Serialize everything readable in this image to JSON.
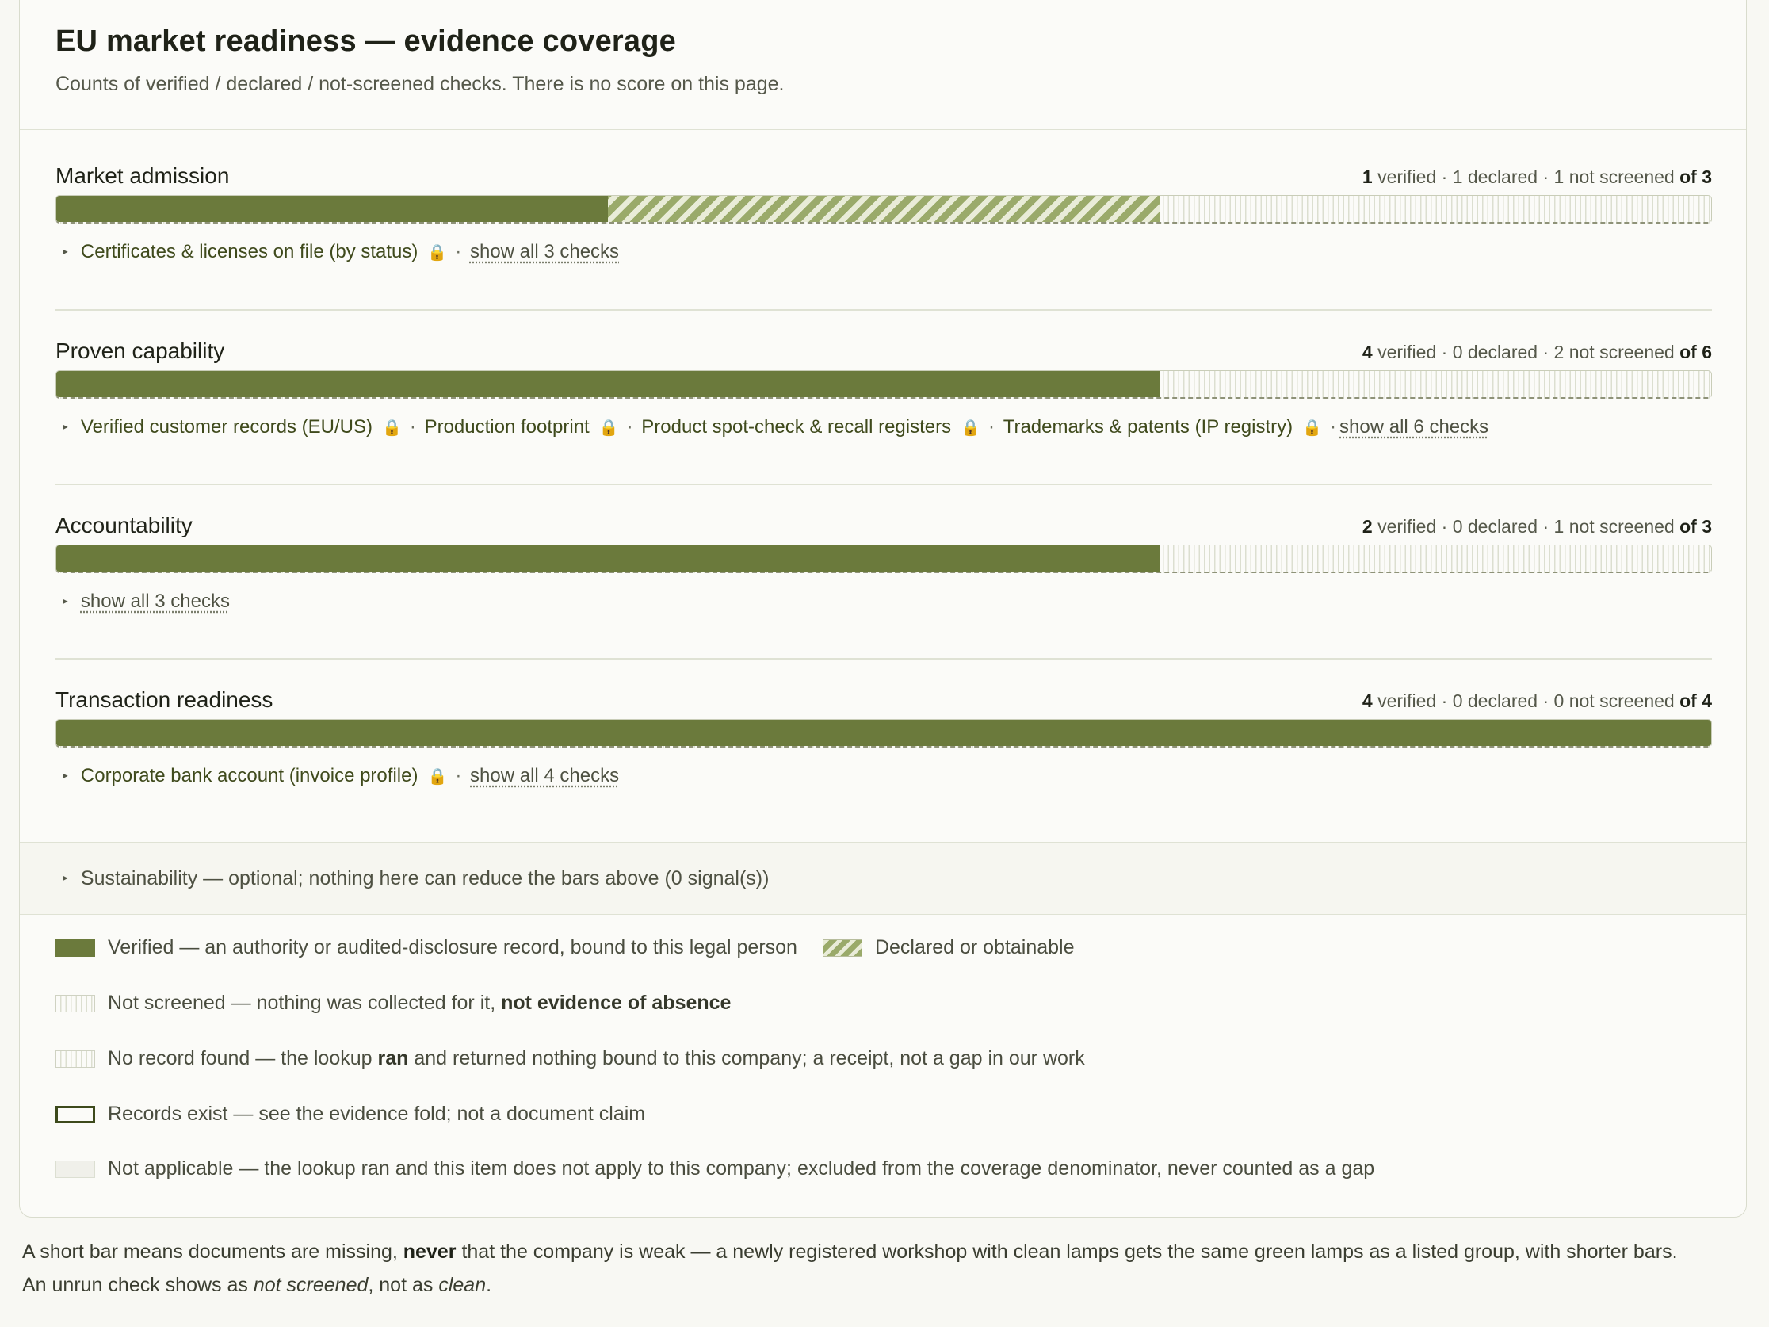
{
  "header": {
    "title": "EU market readiness — evidence coverage",
    "subtitle": "Counts of verified / declared / not-screened checks. There is no score on this page."
  },
  "sections": [
    {
      "name": "Market admission",
      "verified": 1,
      "declared": 1,
      "not_screened": 1,
      "total": 3,
      "count_verified": "1",
      "count_verified_label": " verified · ",
      "count_declared": "1 declared · ",
      "count_not": "1 not screened ",
      "count_of": "of 3",
      "checks": [
        {
          "label": "Certificates & licenses on file (by status)"
        }
      ],
      "show_all": "show all 3 checks"
    },
    {
      "name": "Proven capability",
      "verified": 4,
      "declared": 0,
      "not_screened": 2,
      "total": 6,
      "count_verified": "4",
      "count_verified_label": " verified · ",
      "count_declared": "0 declared · ",
      "count_not": "2 not screened ",
      "count_of": "of 6",
      "checks": [
        {
          "label": "Verified customer records (EU/US)"
        },
        {
          "label": "Production footprint"
        },
        {
          "label": "Product spot-check & recall registers"
        },
        {
          "label": "Trademarks & patents (IP registry)"
        }
      ],
      "show_all": "show all 6 checks"
    },
    {
      "name": "Accountability",
      "verified": 2,
      "declared": 0,
      "not_screened": 1,
      "total": 3,
      "count_verified": "2",
      "count_verified_label": " verified · ",
      "count_declared": "0 declared · ",
      "count_not": "1 not screened ",
      "count_of": "of 3",
      "checks": [],
      "show_all": "show all 3 checks"
    },
    {
      "name": "Transaction readiness",
      "verified": 4,
      "declared": 0,
      "not_screened": 0,
      "total": 4,
      "count_verified": "4",
      "count_verified_label": " verified · ",
      "count_declared": "0 declared · ",
      "count_not": "0 not screened ",
      "count_of": "of 4",
      "checks": [
        {
          "label": "Corporate bank account (invoice profile)"
        }
      ],
      "show_all": "show all 4 checks"
    }
  ],
  "sustainability": "Sustainability — optional; nothing here can reduce the bars above (0 signal(s))",
  "legend": {
    "verified": "Verified — an authority or audited-disclosure record, bound to this legal person",
    "declared": "Declared or obtainable",
    "not_screened_a": "Not screened — nothing was collected for it, ",
    "not_screened_b": "not evidence of absence",
    "no_record_a": "No record found — the lookup ",
    "no_record_b": "ran",
    "no_record_c": " and returned nothing bound to this company; a receipt, not a gap in our work",
    "records_exist": "Records exist — see the evidence fold; not a document claim",
    "not_applicable": "Not applicable — the lookup ran and this item does not apply to this company; excluded from the coverage denominator, never counted as a gap"
  },
  "footer": {
    "l1a": "A short bar means documents are missing, ",
    "l1b": "never",
    "l1c": " that the company is weak — a newly registered workshop with clean lamps gets the same green lamps as a listed group, with shorter bars.",
    "l2a": "An unrun check shows as ",
    "l2b": "not screened",
    "l2c": ", not as ",
    "l2d": "clean",
    "l2e": "."
  },
  "icons": {
    "lock": "lock-icon",
    "expand": "triangle-right-icon"
  },
  "colors": {
    "verified": "#6b7a3c",
    "declared": "#9aaa6a",
    "text": "#2b2b22"
  }
}
